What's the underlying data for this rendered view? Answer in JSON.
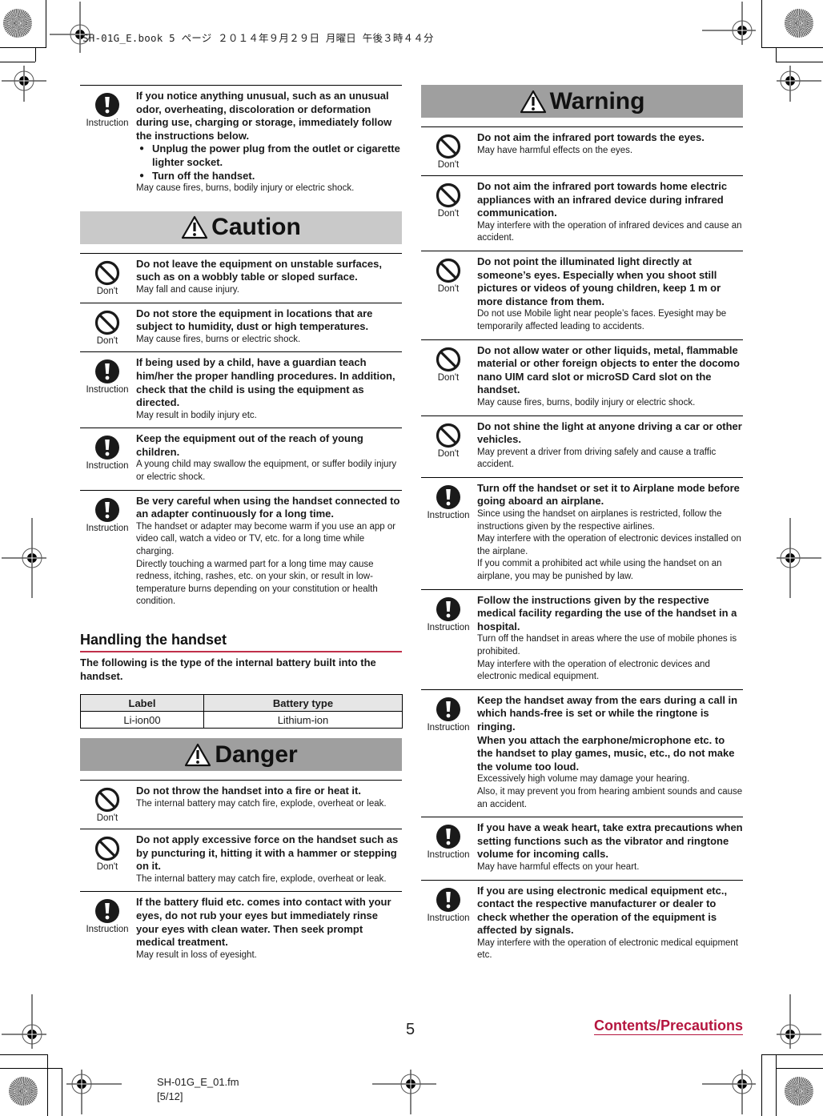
{
  "print_header": "SH-01G_E.book  5 ページ  ２０１４年９月２９日  月曜日  午後３時４４分",
  "icons": {
    "dont_label": "Don't",
    "instruction_label": "Instruction"
  },
  "left_column": {
    "top_item": {
      "type": "instruction",
      "heading": "If you notice anything unusual, such as an unusual odor, overheating, discoloration or deformation during use, charging or storage, immediately follow the instructions below.",
      "bullets": [
        "Unplug the power plug from the outlet or cigarette lighter socket.",
        "Turn off the handset."
      ],
      "note": "May cause fires, burns, bodily injury or electric shock."
    },
    "caution": {
      "title": "Caution",
      "items": [
        {
          "type": "dont",
          "heading": "Do not leave the equipment on unstable surfaces, such as on a wobbly table or sloped surface.",
          "notes": [
            "May fall and cause injury."
          ]
        },
        {
          "type": "dont",
          "heading": "Do not store the equipment in locations that are subject to humidity, dust or high temperatures.",
          "notes": [
            "May cause fires, burns or electric shock."
          ]
        },
        {
          "type": "instruction",
          "heading": "If being used by a child, have a guardian teach him/her the proper handling procedures. In addition, check that the child is using the equipment as directed.",
          "notes": [
            "May result in bodily injury etc."
          ]
        },
        {
          "type": "instruction",
          "heading": "Keep the equipment out of the reach of young children.",
          "notes": [
            "A young child may swallow the equipment, or suffer bodily injury or electric shock."
          ]
        },
        {
          "type": "instruction",
          "heading": "Be very careful when using the handset connected to an adapter continuously for a long time.",
          "notes": [
            "The handset or adapter may become warm if you use an app or video call, watch a video or TV, etc. for a long time while charging.",
            "Directly touching a warmed part for a long time may cause redness, itching, rashes, etc. on your skin, or result in low-temperature burns depending on your constitution or health condition."
          ]
        }
      ]
    },
    "handling": {
      "title": "Handling the handset",
      "intro": "The following is the type of the internal battery built into the handset.",
      "table": {
        "headers": [
          "Label",
          "Battery type"
        ],
        "rows": [
          [
            "Li-ion00",
            "Lithium-ion"
          ]
        ]
      }
    },
    "danger": {
      "title": "Danger",
      "items": [
        {
          "type": "dont",
          "heading": "Do not throw the handset into a fire or heat it.",
          "notes": [
            "The internal battery may catch fire, explode, overheat or leak."
          ]
        },
        {
          "type": "dont",
          "heading": "Do not apply excessive force on the handset such as by puncturing it, hitting it with a hammer or stepping on it.",
          "notes": [
            "The internal battery may catch fire, explode, overheat or leak."
          ]
        },
        {
          "type": "instruction",
          "heading": "If the battery fluid etc. comes into contact with your eyes, do not rub your eyes but immediately rinse your eyes with clean water. Then seek prompt medical treatment.",
          "notes": [
            "May result in loss of eyesight."
          ]
        }
      ]
    }
  },
  "right_column": {
    "warning": {
      "title": "Warning",
      "items": [
        {
          "type": "dont",
          "heading": "Do not aim the infrared port towards the eyes.",
          "notes": [
            "May have harmful effects on the eyes."
          ]
        },
        {
          "type": "dont",
          "heading": "Do not aim the infrared port towards home electric appliances with an infrared device during infrared communication.",
          "notes": [
            "May interfere with the operation of infrared devices and cause an accident."
          ]
        },
        {
          "type": "dont",
          "heading": "Do not point the illuminated light directly at someone’s eyes. Especially when you shoot still pictures or videos of young children, keep 1 m or more distance from them.",
          "notes": [
            "Do not use Mobile light near people’s faces. Eyesight may be temporarily affected leading to accidents."
          ]
        },
        {
          "type": "dont",
          "heading": "Do not allow water or other liquids, metal, flammable material or other foreign objects to enter the docomo nano UIM card slot or microSD Card slot on the handset.",
          "notes": [
            "May cause fires, burns, bodily injury or electric shock."
          ]
        },
        {
          "type": "dont",
          "heading": "Do not shine the light at anyone driving a car or other vehicles.",
          "notes": [
            "May prevent a driver from driving safely and cause a traffic accident."
          ]
        },
        {
          "type": "instruction",
          "heading": "Turn off the handset or set it to Airplane mode before going aboard an airplane.",
          "notes": [
            "Since using the handset on airplanes is restricted, follow the instructions given by the respective airlines.",
            "May interfere with the operation of electronic devices installed on the airplane.",
            "If you commit a prohibited act while using the handset on an airplane, you may be punished by law."
          ]
        },
        {
          "type": "instruction",
          "heading": "Follow the instructions given by the respective medical facility regarding the use of the handset in a hospital.",
          "notes": [
            "Turn off the handset in areas where the use of mobile phones is prohibited.",
            "May interfere with the operation of electronic devices and electronic medical equipment."
          ]
        },
        {
          "type": "instruction",
          "heading": "Keep the handset away from the ears during a call in which hands-free is set or while the ringtone is ringing.",
          "heading2": "When you attach the earphone/microphone etc. to the handset to play games, music, etc., do not make the volume too loud.",
          "notes": [
            "Excessively high volume may damage your hearing.",
            "Also, it may prevent you from hearing ambient sounds and cause an accident."
          ]
        },
        {
          "type": "instruction",
          "heading": "If you have a weak heart, take extra precautions when setting functions such as the vibrator and ringtone volume for incoming calls.",
          "notes": [
            "May have harmful effects on your heart."
          ]
        },
        {
          "type": "instruction",
          "heading": "If you are using electronic medical equipment etc., contact the respective manufacturer or dealer to check whether the operation of the equipment is affected by signals.",
          "notes": [
            "May interfere with the operation of electronic medical equipment etc."
          ]
        }
      ]
    }
  },
  "footer": {
    "page_number": "5",
    "section_link": "Contents/Precautions",
    "filename": "SH-01G_E_01.fm",
    "page_range": "[5/12]"
  },
  "colors": {
    "accent": "#b5163f",
    "section_rule": "#c0304a",
    "caution_banner": "#c9c9c9",
    "danger_banner": "#9f9f9f",
    "warning_banner": "#9f9f9f"
  }
}
